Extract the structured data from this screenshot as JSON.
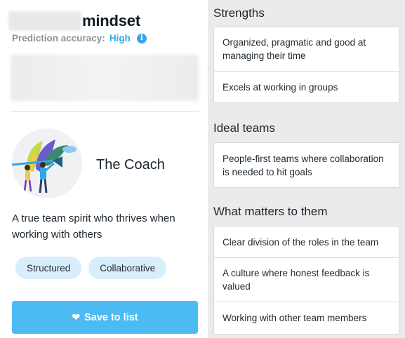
{
  "profile": {
    "title_suffix": "mindset",
    "accuracy_label": "Prediction accuracy:",
    "accuracy_value": "High",
    "info_icon": "info-icon",
    "persona_name": "The Coach",
    "persona_description": "A true team spirit who thrives when working with others",
    "tags": [
      "Structured",
      "Collaborative"
    ],
    "save_button": "Save to list",
    "save_icon": "heart-icon",
    "accent_color": "#4cbaf3"
  },
  "strengths": {
    "title": "Strengths",
    "items": [
      "Organized, pragmatic and good at managing their time",
      "Excels at working in groups"
    ]
  },
  "ideal_teams": {
    "title": "Ideal teams",
    "items": [
      "People-first teams where collaboration is needed to hit goals"
    ]
  },
  "what_matters": {
    "title": "What matters to them",
    "items": [
      "Clear division of the roles in the team",
      "A culture where honest feedback is valued",
      "Working with other team members"
    ]
  }
}
